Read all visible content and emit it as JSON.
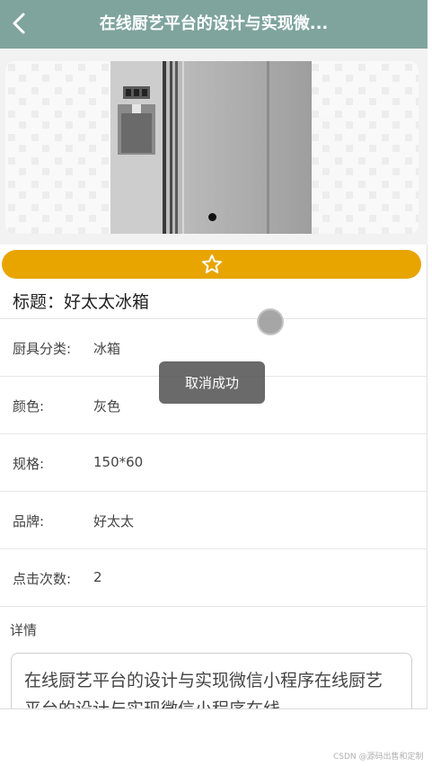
{
  "navbar": {
    "title": "在线厨艺平台的设计与实现微..."
  },
  "banner": {
    "image": "refrigerator-photo",
    "indicator_count": 1,
    "active_index": 0
  },
  "favorite": {
    "icon": "star-outline-icon",
    "color": "#e8a500"
  },
  "product": {
    "title_label": "标题：",
    "title_value": "好太太冰箱",
    "fields": [
      {
        "label": "厨具分类:",
        "value": "冰箱"
      },
      {
        "label": "颜色:",
        "value": "灰色"
      },
      {
        "label": "规格:",
        "value": "150*60"
      },
      {
        "label": "品牌:",
        "value": "好太太"
      },
      {
        "label": "点击次数:",
        "value": "2"
      }
    ],
    "detail_label": "详情",
    "detail_text": "在线厨艺平台的设计与实现微信小程序在线厨艺平台的设计与实现微信小程序在线"
  },
  "toast": {
    "text": "取消成功"
  },
  "watermark": "CSDN @源码出售和定制",
  "colors": {
    "navbar": "#7fa49e",
    "favorite_bar": "#e8a500"
  }
}
